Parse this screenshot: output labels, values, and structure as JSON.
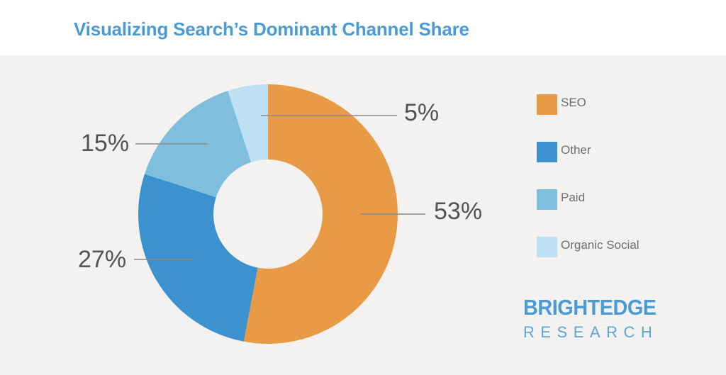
{
  "header": {
    "title": "Visualizing Search’s Dominant Channel Share"
  },
  "brand": {
    "name": "BRIGHTEDGE",
    "sub": "RESEARCH"
  },
  "theme": {
    "page_background": "#FFFFFF",
    "panel_background": "#F4F2F0",
    "title_color": "#4A9BD4",
    "label_color": "#545454",
    "legend_text_color": "#6E6E6E",
    "leader_line_color": "#8A8A8A",
    "hole_color": "#F4F2F0"
  },
  "legend": {
    "position": "right",
    "items": [
      {
        "label": "SEO",
        "color": "#E89B44"
      },
      {
        "label": "Other",
        "color": "#3B92CE"
      },
      {
        "label": "Paid",
        "color": "#7FBEDC"
      },
      {
        "label": "Organic Social",
        "color": "#BFDFF2"
      }
    ]
  },
  "chart_data": {
    "type": "pie",
    "variant": "donut",
    "title": "Visualizing Search’s Dominant Channel Share",
    "xlabel": "",
    "ylabel": "",
    "units": "percent",
    "total": 100,
    "start_angle_deg": 0,
    "direction": "clockwise",
    "inner_radius_ratio": 0.42,
    "labels": [
      "SEO",
      "Other",
      "Paid",
      "Organic Social"
    ],
    "values": [
      53,
      27,
      15,
      5
    ],
    "colors": [
      "#E89B44",
      "#3B92CE",
      "#7FBEDC",
      "#BFDFF2"
    ],
    "data_labels": [
      "53%",
      "27%",
      "15%",
      "5%"
    ],
    "slices": [
      {
        "label": "SEO",
        "value": 53,
        "display": "53%",
        "color": "#E89B44",
        "start_deg": 0,
        "end_deg": 190.8
      },
      {
        "label": "Other",
        "value": 27,
        "display": "27%",
        "color": "#3B92CE",
        "start_deg": 190.8,
        "end_deg": 288.0
      },
      {
        "label": "Paid",
        "value": 15,
        "display": "15%",
        "color": "#7FBEDC",
        "start_deg": 288.0,
        "end_deg": 342.0
      },
      {
        "label": "Organic Social",
        "value": 5,
        "display": "5%",
        "color": "#BFDFF2",
        "start_deg": 342.0,
        "end_deg": 360.0
      }
    ],
    "legend_position": "right",
    "grid": false
  }
}
